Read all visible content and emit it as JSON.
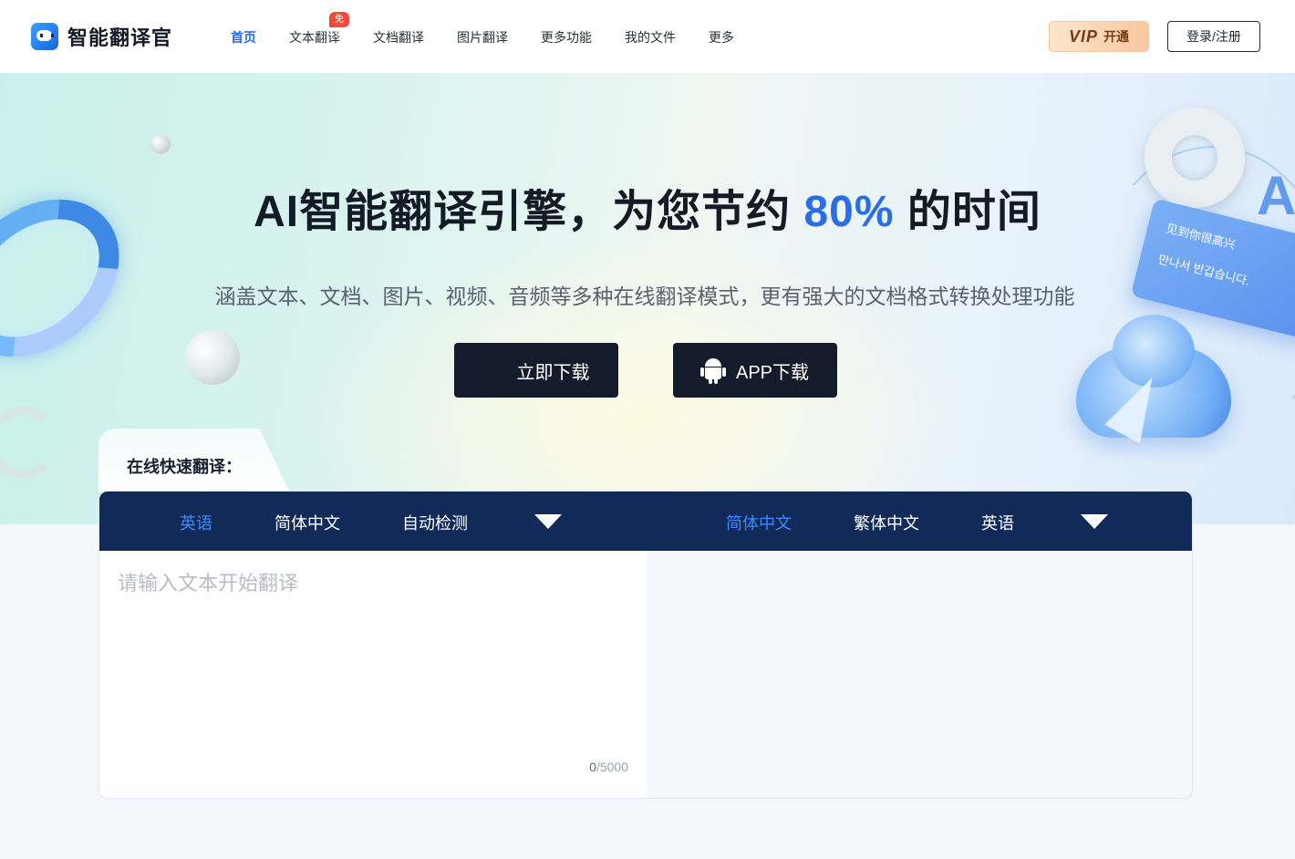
{
  "brand": {
    "name": "智能翻译官"
  },
  "nav": {
    "items": [
      {
        "label": "首页",
        "active": true
      },
      {
        "label": "文本翻译",
        "active": false
      },
      {
        "label": "文档翻译",
        "active": false
      },
      {
        "label": "图片翻译",
        "active": false
      },
      {
        "label": "更多功能",
        "active": false
      },
      {
        "label": "我的文件",
        "active": false
      },
      {
        "label": "更多",
        "active": false
      }
    ],
    "badge": "免费"
  },
  "header": {
    "vip": {
      "brand": "VIP",
      "label": "开通"
    },
    "login_label": "登录/注册"
  },
  "hero": {
    "title_prefix": "AI智能翻译引擎，为您节约 ",
    "title_highlight": "80%",
    "title_suffix": " 的时间",
    "subtitle": "涵盖文本、文档、图片、视频、音频等多种在线翻译模式，更有强大的文档格式转换处理功能",
    "download_label": "立即下载",
    "app_download_label": "APP下载",
    "accent_color": "#2b6ce8",
    "card_line1": "见到你很高兴",
    "card_line2": "만나서 반갑습니다.",
    "deco_letter": "A"
  },
  "translator": {
    "section_label": "在线快速翻译：",
    "source_langs": [
      {
        "label": "英语",
        "active": true
      },
      {
        "label": "简体中文",
        "active": false
      },
      {
        "label": "自动检测",
        "active": false
      }
    ],
    "target_langs": [
      {
        "label": "简体中文",
        "active": true
      },
      {
        "label": "繁体中文",
        "active": false
      },
      {
        "label": "英语",
        "active": false
      }
    ],
    "placeholder": "请输入文本开始翻译",
    "input_value": "",
    "char_count": "0",
    "char_limit": "/5000",
    "bar_color": "#112a57"
  }
}
